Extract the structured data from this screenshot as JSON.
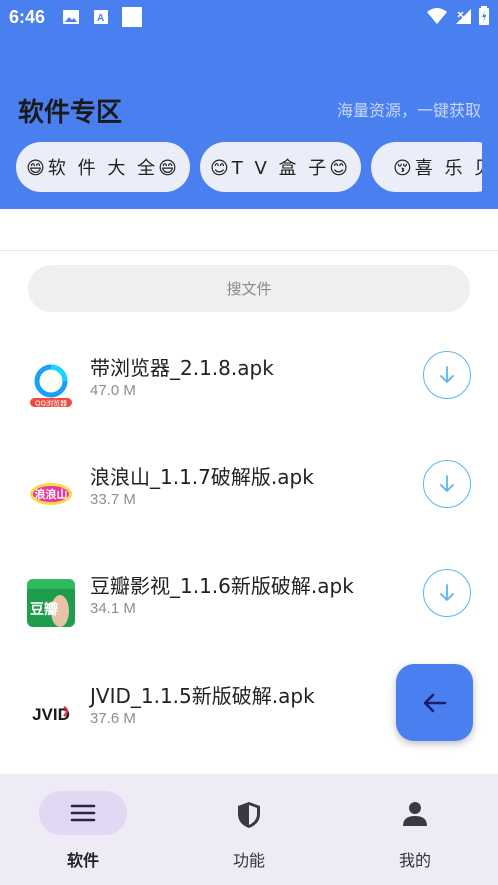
{
  "status_bar": {
    "time": "6:46",
    "icons": [
      "image-icon",
      "font-app-icon",
      "white-square-icon",
      "wifi-icon",
      "signal-icon",
      "battery-icon"
    ]
  },
  "header": {
    "title": "软件专区",
    "slogan": "海量资源，一键获取",
    "background": "#4a7ff0"
  },
  "tabs": [
    {
      "label": "😄软 件 大 全😄"
    },
    {
      "label": "😊T V 盒 子😊"
    },
    {
      "label": "😚喜 乐 见"
    }
  ],
  "search": {
    "placeholder": "搜文件"
  },
  "files": [
    {
      "name": "带浏览器_2.1.8.apk",
      "size": "47.0 M",
      "icon": "qq-browser-icon",
      "icon_text": "QQ浏览器"
    },
    {
      "name": "浪浪山_1.1.7破解版.apk",
      "size": "33.7 M",
      "icon": "langlangshan-icon",
      "icon_text": "浪浪山"
    },
    {
      "name": "豆瓣影视_1.1.6新版破解.apk",
      "size": "34.1 M",
      "icon": "douban-video-icon",
      "icon_text": "豆瓣"
    },
    {
      "name": "JVID_1.1.5新版破解.apk",
      "size": "37.6 M",
      "icon": "jvid-icon",
      "icon_text": "JVID"
    }
  ],
  "bottom_nav": [
    {
      "label": "软件",
      "icon": "menu-icon",
      "active": true
    },
    {
      "label": "功能",
      "icon": "shield-icon",
      "active": false
    },
    {
      "label": "我的",
      "icon": "person-icon",
      "active": false
    }
  ],
  "colors": {
    "accent": "#4a7ff0",
    "download_ring": "#57b7f2",
    "nav_bg": "#efebf6",
    "nav_active_pill": "#e1d8f3"
  }
}
